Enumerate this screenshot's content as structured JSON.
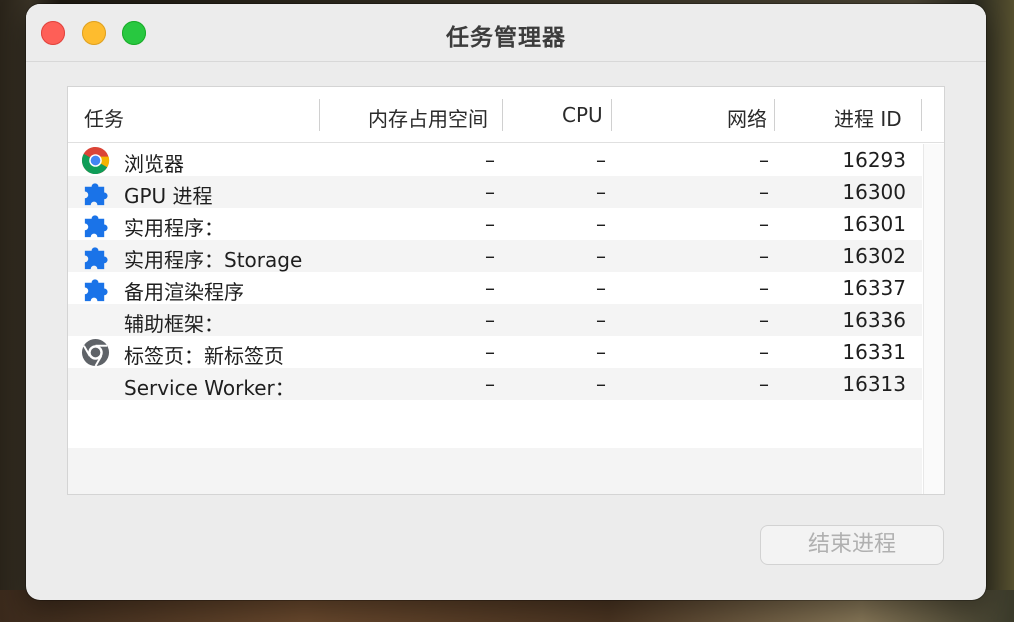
{
  "window": {
    "title": "任务管理器"
  },
  "table": {
    "columns": {
      "task": "任务",
      "memory": "内存占用空间",
      "cpu": "CPU",
      "network": "网络",
      "pid": "进程 ID"
    },
    "rows": [
      {
        "name": "浏览器",
        "icon": "chrome-icon",
        "memory": "–",
        "cpu": "–",
        "network": "–",
        "pid": "16293"
      },
      {
        "name": "GPU 进程",
        "icon": "puzzle-icon",
        "memory": "–",
        "cpu": "–",
        "network": "–",
        "pid": "16300"
      },
      {
        "name": "实用程序：",
        "icon": "puzzle-icon",
        "memory": "–",
        "cpu": "–",
        "network": "–",
        "pid": "16301"
      },
      {
        "name": "实用程序：Storage",
        "icon": "puzzle-icon",
        "memory": "–",
        "cpu": "–",
        "network": "–",
        "pid": "16302"
      },
      {
        "name": "备用渲染程序",
        "icon": "puzzle-icon",
        "memory": "–",
        "cpu": "–",
        "network": "–",
        "pid": "16337"
      },
      {
        "name": "辅助框架：",
        "icon": "",
        "memory": "–",
        "cpu": "–",
        "network": "–",
        "pid": "16336"
      },
      {
        "name": "标签页：新标签页",
        "icon": "chrome-gray-icon",
        "memory": "–",
        "cpu": "–",
        "network": "–",
        "pid": "16331"
      },
      {
        "name": "Service Worker：",
        "icon": "",
        "memory": "–",
        "cpu": "–",
        "network": "–",
        "pid": "16313"
      }
    ]
  },
  "footer": {
    "end_process_label": "结束进程"
  },
  "colors": {
    "close": "#fe5f57",
    "minimize": "#febc2e",
    "maximize": "#28c840",
    "puzzle_icon": "#1a73e8"
  }
}
